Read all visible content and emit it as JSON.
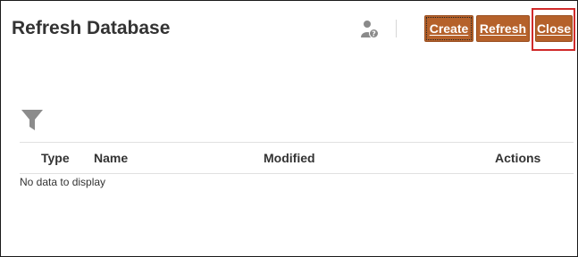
{
  "page": {
    "title": "Refresh Database"
  },
  "header": {
    "user_icon": "user-help-icon"
  },
  "toolbar": {
    "create_label": "Create",
    "refresh_label": "Refresh",
    "close_label": "Close"
  },
  "filter": {
    "icon": "filter-icon"
  },
  "table": {
    "columns": [
      "Type",
      "Name",
      "Modified",
      "Actions"
    ],
    "empty_message": "No data to display"
  },
  "colors": {
    "button_bg": "#b5612a",
    "highlight": "#d02a2a",
    "text": "#333333"
  }
}
